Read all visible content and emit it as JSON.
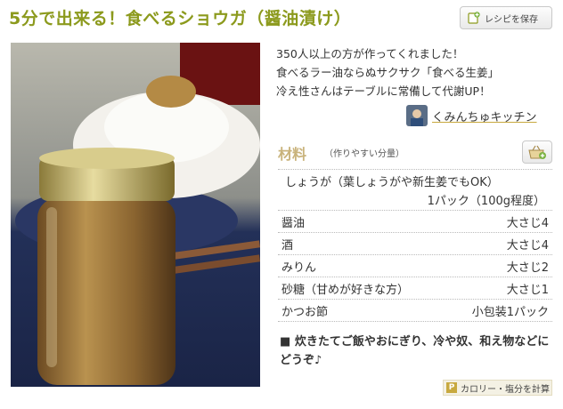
{
  "recipe": {
    "title": "5分で出来る！食べるショウガ（醤油漬け）",
    "save_label": "レシピを保存",
    "description": [
      "350人以上の方が作ってくれました！",
      "食べるラー油ならぬサクサク「食べる生姜」",
      "冷え性さんはテーブルに常備して代謝UP！"
    ],
    "author": "くみんちゅキッチン"
  },
  "ingredients": {
    "heading": "材料",
    "note": "（作りやすい分量）",
    "items": [
      {
        "name": "しょうが（葉しょうがや新生姜でもOK）",
        "qty": "1パック（100g程度）"
      },
      {
        "name": "醤油",
        "qty": "大さじ4"
      },
      {
        "name": "酒",
        "qty": "大さじ4"
      },
      {
        "name": "みりん",
        "qty": "大さじ2"
      },
      {
        "name": "砂糖（甘めが好きな方）",
        "qty": "大さじ1"
      },
      {
        "name": "かつお節",
        "qty": "小包装1パック"
      }
    ]
  },
  "tip": {
    "marker": "■",
    "text": "炊きたてご飯やおにぎり、冷や奴、和え物などにどうぞ♪"
  },
  "calorie": {
    "badge": "P",
    "label": "カロリー・塩分を計算"
  },
  "colors": {
    "title": "#8c9a1d",
    "heading": "#c9b37c",
    "accent": "#c8a93f"
  },
  "icons": {
    "save": "bookmark-plus-icon",
    "cart": "shopping-basket-icon",
    "calorie": "p-badge-icon"
  }
}
